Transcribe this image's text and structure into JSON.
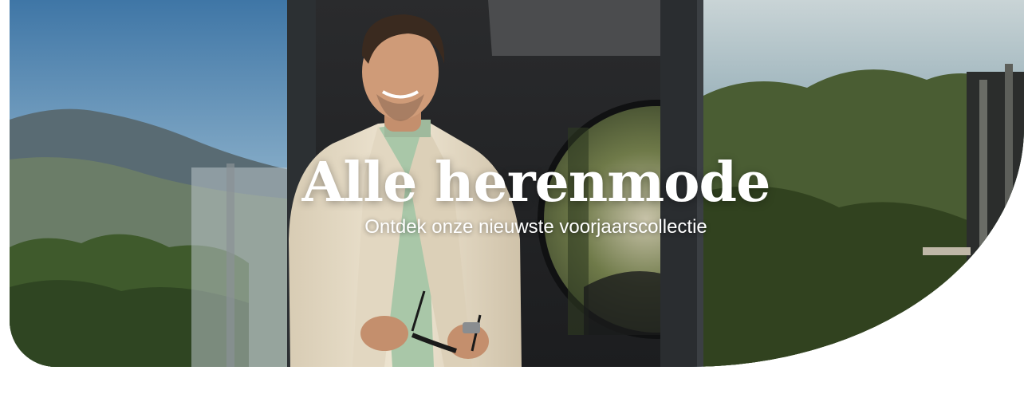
{
  "banner": {
    "title": "Alle herenmode",
    "subtitle": "Ontdek onze nieuwste voorjaarscollectie"
  },
  "colors": {
    "text": "#ffffff",
    "page_background": "#ffffff",
    "sky": "#5b86a8",
    "foliage": "#3f5a2c",
    "door_frame": "#2c3033",
    "jacket": "#e6dcc8",
    "shirt": "#a9c7a8"
  }
}
